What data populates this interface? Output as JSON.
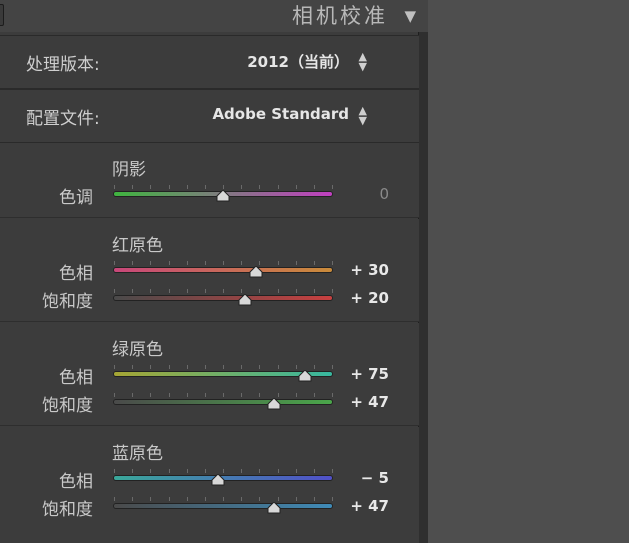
{
  "header": {
    "title": "相机校准",
    "collapse_icon": "triangle-down-icon"
  },
  "process": {
    "label": "处理版本:",
    "value": "2012（当前）"
  },
  "profile": {
    "label": "配置文件:",
    "value": "Adobe Standard"
  },
  "shadows": {
    "title": "阴影",
    "tint": {
      "label": "色调",
      "value": "0",
      "level": 0.5,
      "track_colors": [
        "#3fb53f",
        "#c13fc1"
      ]
    }
  },
  "red_primary": {
    "title": "红原色",
    "hue": {
      "label": "色相",
      "value": "+ 30",
      "level": 0.65,
      "track_colors": [
        "#c8477a",
        "#c98b3a"
      ]
    },
    "saturation": {
      "label": "饱和度",
      "value": "+ 20",
      "level": 0.6,
      "track_colors": [
        "#4a4a4a",
        "#c84040"
      ]
    }
  },
  "green_primary": {
    "title": "绿原色",
    "hue": {
      "label": "色相",
      "value": "+ 75",
      "level": 0.875,
      "track_colors": [
        "#a6a634",
        "#37b8a0"
      ]
    },
    "saturation": {
      "label": "饱和度",
      "value": "+ 47",
      "level": 0.735,
      "track_colors": [
        "#4a4a4a",
        "#4aa64a"
      ]
    }
  },
  "blue_primary": {
    "title": "蓝原色",
    "hue": {
      "label": "色相",
      "value": "− 5",
      "level": 0.475,
      "track_colors": [
        "#3aa89a",
        "#5050c8"
      ]
    },
    "saturation": {
      "label": "饱和度",
      "value": "+ 47",
      "level": 0.735,
      "track_colors": [
        "#4a4a4a",
        "#3f8bb8"
      ]
    }
  }
}
